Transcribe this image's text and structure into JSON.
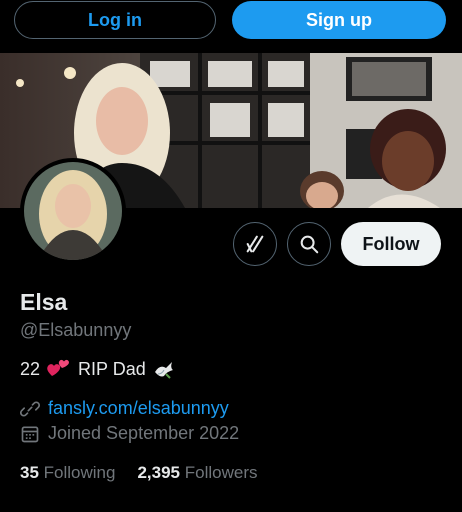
{
  "auth": {
    "login_label": "Log in",
    "signup_label": "Sign up"
  },
  "profile": {
    "name": "Elsa",
    "handle": "@Elsabunnyy",
    "bio_prefix": "22",
    "bio_text": "RIP Dad",
    "link": "fansly.com/elsabunnyy",
    "joined": "Joined September 2022",
    "following_count": "35",
    "following_label": "Following",
    "followers_count": "2,395",
    "followers_label": "Followers"
  },
  "actions": {
    "follow_label": "Follow",
    "grok_icon": "grok-icon",
    "search_icon": "search-icon"
  },
  "colors": {
    "accent": "#1d9bf0",
    "background": "#000000",
    "muted": "#71767b"
  }
}
